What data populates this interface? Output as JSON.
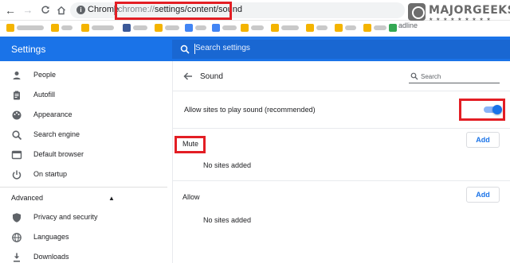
{
  "browser": {
    "omnibox_brand": "Chrome",
    "url_scheme": "chrome://",
    "url_path": "settings/content/sound",
    "bookmark_visible_text": "adline"
  },
  "watermark": {
    "text": "MAJORGEEKS",
    "stars": "★ ★ ★ ★ ★ ★ ★ ★ ★"
  },
  "header": {
    "title": "Settings",
    "search_placeholder": "Search settings"
  },
  "sidebar": {
    "items": [
      {
        "label": "People",
        "icon": "person-icon"
      },
      {
        "label": "Autofill",
        "icon": "clipboard-icon"
      },
      {
        "label": "Appearance",
        "icon": "palette-icon"
      },
      {
        "label": "Search engine",
        "icon": "search-icon"
      },
      {
        "label": "Default browser",
        "icon": "browser-icon"
      },
      {
        "label": "On startup",
        "icon": "power-icon"
      }
    ],
    "advanced_label": "Advanced",
    "advanced_arrow": "▲",
    "advanced_items": [
      {
        "label": "Privacy and security",
        "icon": "shield-icon"
      },
      {
        "label": "Languages",
        "icon": "globe-icon"
      },
      {
        "label": "Downloads",
        "icon": "download-icon"
      }
    ]
  },
  "main": {
    "page_title": "Sound",
    "search_placeholder": "Search",
    "allow_sound_label": "Allow sites to play sound (recommended)",
    "allow_sound_enabled": true,
    "mute": {
      "label": "Mute",
      "add_label": "Add",
      "empty_text": "No sites added"
    },
    "allow": {
      "label": "Allow",
      "add_label": "Add",
      "empty_text": "No sites added"
    }
  },
  "colors": {
    "accent": "#1a73e8",
    "highlight_box": "#e31e24",
    "header_bg": "#1a73e8"
  }
}
